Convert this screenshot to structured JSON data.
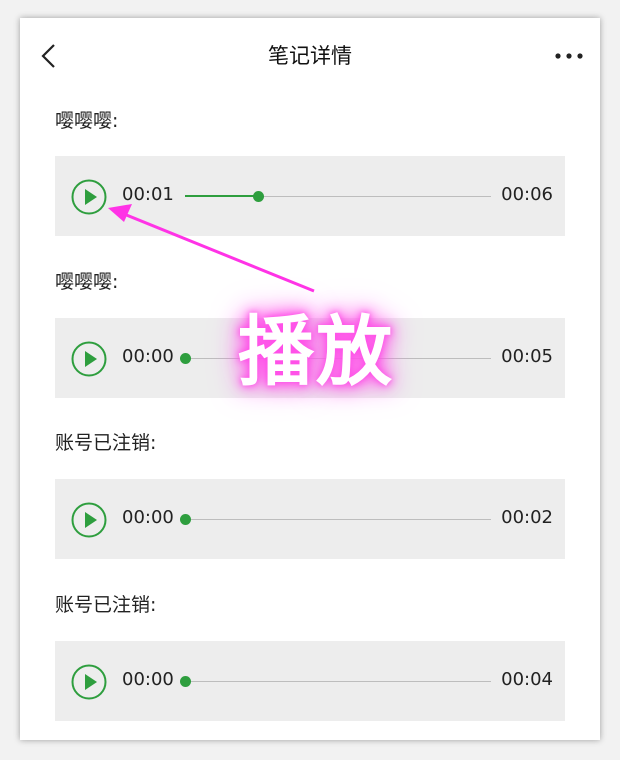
{
  "header": {
    "title": "笔记详情",
    "back_icon": "chevron-left-icon",
    "more_icon": "more-dots-icon"
  },
  "notes": [
    {
      "author": "嘤嘤嘤:",
      "current": "00:01",
      "duration": "00:06",
      "progress": 0.24
    },
    {
      "author": "嘤嘤嘤:",
      "current": "00:00",
      "duration": "00:05",
      "progress": 0
    },
    {
      "author": "账号已注销:",
      "current": "00:00",
      "duration": "00:02",
      "progress": 0
    },
    {
      "author": "账号已注销:",
      "current": "00:00",
      "duration": "00:04",
      "progress": 0
    }
  ],
  "annotation": {
    "text": "播放",
    "color": "#ff33e6"
  },
  "colors": {
    "accent": "#2e9e3e",
    "player_bg": "#ededed"
  }
}
